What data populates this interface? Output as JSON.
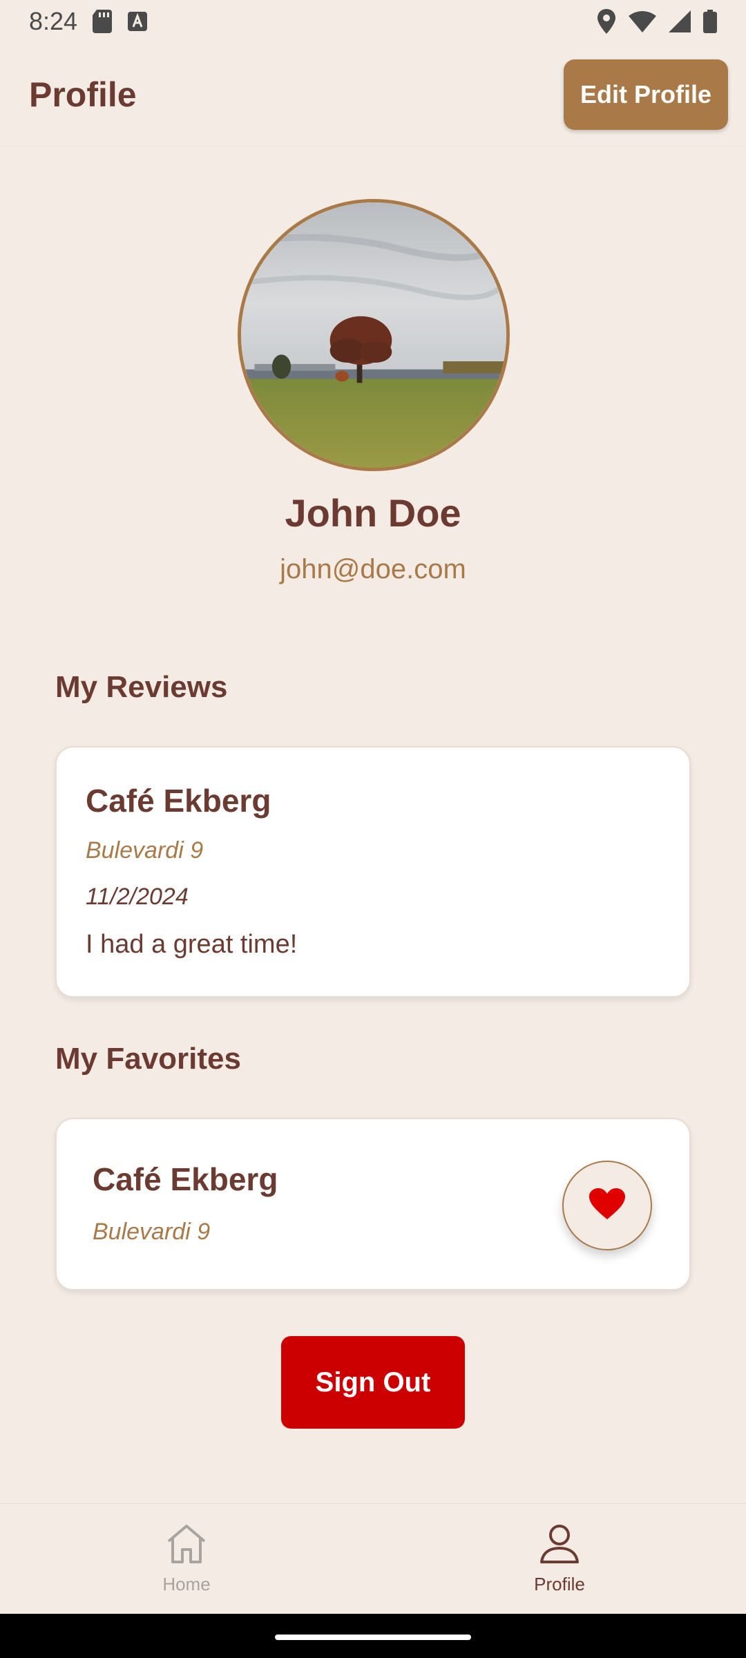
{
  "status_bar": {
    "time": "8:24",
    "icons_left": [
      "sd-card-icon",
      "a-badge-icon"
    ],
    "icons_right": [
      "location-icon",
      "wifi-icon",
      "signal-icon",
      "battery-icon"
    ]
  },
  "app_bar": {
    "title": "Profile",
    "edit_button_label": "Edit Profile"
  },
  "profile": {
    "name": "John Doe",
    "email": "john@doe.com"
  },
  "reviews": {
    "section_title": "My Reviews",
    "items": [
      {
        "place": "Café Ekberg",
        "address": "Bulevardi 9",
        "date": "11/2/2024",
        "text": "I had a great time!"
      }
    ]
  },
  "favorites": {
    "section_title": "My Favorites",
    "items": [
      {
        "place": "Café Ekberg",
        "address": "Bulevardi 9",
        "favorited": true
      }
    ]
  },
  "sign_out_label": "Sign Out",
  "bottom_nav": {
    "items": [
      {
        "label": "Home",
        "icon": "home-icon",
        "active": false
      },
      {
        "label": "Profile",
        "icon": "person-icon",
        "active": true
      }
    ]
  },
  "colors": {
    "background": "#f3ebe4",
    "primary_text": "#6b3a31",
    "accent": "#a97a48",
    "danger": "#cc0000",
    "heart": "#e00000"
  }
}
